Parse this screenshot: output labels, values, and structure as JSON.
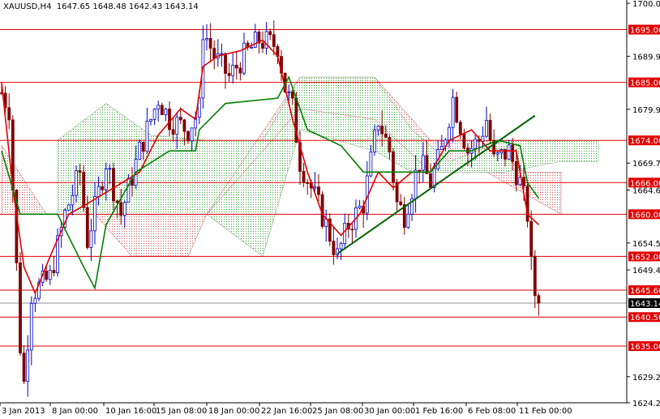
{
  "header": {
    "symbol": "XAUUSD,H4",
    "ohlc": "1647.65 1648.48 1642.43 1643.14"
  },
  "chart_data": {
    "type": "candlestick",
    "title": "XAUUSD,H4",
    "ylim": [
      1624.25,
      1700.0
    ],
    "y_ticks": [
      "1700.00",
      "1689.95",
      "1679.90",
      "1669.70",
      "1664.60",
      "1654.55",
      "1649.45",
      "1629.20",
      "1624.25"
    ],
    "x_ticks": [
      "3 Jan 2013",
      "8 Jan 00:00",
      "10 Jan 16:00",
      "15 Jan 08:00",
      "18 Jan 00:00",
      "22 Jan 16:00",
      "25 Jan 08:00",
      "30 Jan 00:00",
      "1 Feb 16:00",
      "6 Feb 08:00",
      "11 Feb 00:00"
    ],
    "bars_total": 145,
    "price_path": [
      [
        0,
        1683
      ],
      [
        2,
        1680
      ],
      [
        5,
        1635
      ],
      [
        6,
        1628
      ],
      [
        8,
        1645
      ],
      [
        13,
        1648
      ],
      [
        17,
        1660
      ],
      [
        21,
        1668
      ],
      [
        23,
        1655
      ],
      [
        28,
        1670
      ],
      [
        32,
        1660
      ],
      [
        37,
        1672
      ],
      [
        42,
        1682
      ],
      [
        45,
        1678
      ],
      [
        50,
        1676
      ],
      [
        53,
        1680
      ],
      [
        54,
        1695
      ],
      [
        57,
        1690
      ],
      [
        61,
        1686
      ],
      [
        65,
        1690
      ],
      [
        69,
        1693
      ],
      [
        74,
        1692
      ],
      [
        76,
        1684
      ],
      [
        78,
        1680
      ],
      [
        80,
        1670
      ],
      [
        83,
        1665
      ],
      [
        87,
        1658
      ],
      [
        90,
        1652
      ],
      [
        93,
        1658
      ],
      [
        97,
        1662
      ],
      [
        101,
        1678
      ],
      [
        104,
        1672
      ],
      [
        106,
        1662
      ],
      [
        108,
        1660
      ],
      [
        112,
        1670
      ],
      [
        115,
        1666
      ],
      [
        118,
        1672
      ],
      [
        121,
        1682
      ],
      [
        125,
        1672
      ],
      [
        128,
        1674
      ],
      [
        130,
        1678
      ],
      [
        132,
        1670
      ],
      [
        136,
        1672
      ],
      [
        139,
        1666
      ],
      [
        141,
        1660
      ],
      [
        142,
        1650
      ],
      [
        143,
        1645
      ],
      [
        144,
        1643.14
      ]
    ],
    "tenkan_path": [
      [
        0,
        1685
      ],
      [
        3,
        1665
      ],
      [
        6,
        1650
      ],
      [
        9,
        1645
      ],
      [
        13,
        1652
      ],
      [
        18,
        1660
      ],
      [
        23,
        1662
      ],
      [
        30,
        1665
      ],
      [
        37,
        1668
      ],
      [
        42,
        1675
      ],
      [
        48,
        1680
      ],
      [
        52,
        1678
      ],
      [
        54,
        1688
      ],
      [
        58,
        1690
      ],
      [
        64,
        1691
      ],
      [
        70,
        1693
      ],
      [
        74,
        1690
      ],
      [
        78,
        1678
      ],
      [
        82,
        1668
      ],
      [
        86,
        1660
      ],
      [
        91,
        1656
      ],
      [
        96,
        1660
      ],
      [
        101,
        1668
      ],
      [
        105,
        1665
      ],
      [
        110,
        1668
      ],
      [
        115,
        1668
      ],
      [
        120,
        1674
      ],
      [
        126,
        1676
      ],
      [
        131,
        1672
      ],
      [
        138,
        1672
      ],
      [
        141,
        1660
      ],
      [
        144,
        1658
      ]
    ],
    "kijun_path": [
      [
        0,
        1672
      ],
      [
        5,
        1660
      ],
      [
        15,
        1660
      ],
      [
        22,
        1650
      ],
      [
        25,
        1646
      ],
      [
        28,
        1658
      ],
      [
        36,
        1668
      ],
      [
        45,
        1672
      ],
      [
        52,
        1672
      ],
      [
        53,
        1676
      ],
      [
        60,
        1681
      ],
      [
        74,
        1682
      ],
      [
        77,
        1686
      ],
      [
        82,
        1676
      ],
      [
        91,
        1673
      ],
      [
        97,
        1668
      ],
      [
        99,
        1668
      ],
      [
        104,
        1668
      ],
      [
        115,
        1668
      ],
      [
        120,
        1672
      ],
      [
        126,
        1672
      ],
      [
        133,
        1674
      ],
      [
        139,
        1673
      ],
      [
        141,
        1666
      ],
      [
        144,
        1663
      ]
    ],
    "cloud_red": [
      [
        0,
        1673,
        1660
      ],
      [
        12,
        1660,
        1660
      ],
      [
        25,
        1660,
        1660
      ],
      [
        35,
        1660,
        1652
      ],
      [
        50,
        1660,
        1652
      ],
      [
        55,
        1660,
        1660
      ],
      [
        80,
        1686,
        1680
      ],
      [
        100,
        1686,
        1678
      ],
      [
        115,
        1674,
        1668
      ],
      [
        130,
        1674,
        1668
      ],
      [
        140,
        1668,
        1664
      ],
      [
        150,
        1668,
        1660
      ]
    ],
    "cloud_green": [
      [
        15,
        1674,
        1660
      ],
      [
        28,
        1681,
        1660
      ],
      [
        40,
        1675,
        1660
      ],
      [
        55,
        1674,
        1660
      ],
      [
        70,
        1674,
        1652
      ],
      [
        80,
        1686,
        1676
      ],
      [
        100,
        1686,
        1672
      ],
      [
        110,
        1676,
        1668
      ],
      [
        120,
        1670,
        1668
      ],
      [
        135,
        1674,
        1668
      ],
      [
        150,
        1674,
        1670
      ],
      [
        160,
        1674,
        1670
      ]
    ],
    "trendline": [
      [
        90,
        1652.5
      ],
      [
        143,
        1678.7
      ]
    ],
    "levels": [
      1695.0,
      1685.0,
      1674.0,
      1666.0,
      1660.0,
      1652.0,
      1645.6,
      1640.5,
      1635.0
    ],
    "level_labels": [
      "1695.00",
      "1685.00",
      "1674.00",
      "1666.00",
      "1660.00",
      "1652.00",
      "1645.60",
      "1640.50",
      "1635.00"
    ],
    "current_price": 1643.14,
    "current_price_label": "1643.14",
    "colors": {
      "level": "#e00000",
      "up": "#0000c8",
      "down": "#800000",
      "tenkan": "#e00000",
      "kijun": "#008000",
      "trend": "#006400"
    }
  }
}
